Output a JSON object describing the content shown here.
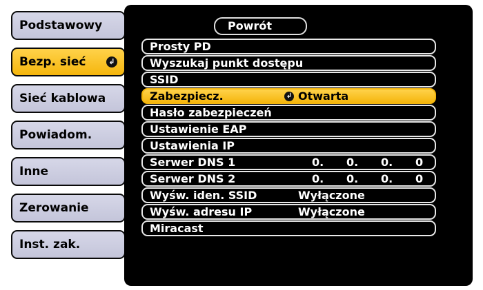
{
  "tabs": [
    {
      "label": "Podstawowy",
      "active": false
    },
    {
      "label": "Bezp. sieć",
      "active": true
    },
    {
      "label": "Sieć kablowa",
      "active": false
    },
    {
      "label": "Powiadom.",
      "active": false
    },
    {
      "label": "Inne",
      "active": false
    },
    {
      "label": "Zerowanie",
      "active": false
    },
    {
      "label": "Inst. zak.",
      "active": false
    }
  ],
  "return_label": "Powrót",
  "rows": [
    {
      "label": "Prosty PD"
    },
    {
      "label": "Wyszukaj punkt dostępu"
    },
    {
      "label": "SSID"
    },
    {
      "label": "Zabezpiecz.",
      "value": "Otwarta",
      "selected": true
    },
    {
      "label": "Hasło zabezpieczeń"
    },
    {
      "label": "Ustawienie EAP"
    },
    {
      "label": "Ustawienia IP"
    },
    {
      "label": "Serwer DNS 1",
      "ip": [
        "0.",
        "0.",
        "0.",
        "0"
      ]
    },
    {
      "label": "Serwer DNS 2",
      "ip": [
        "0.",
        "0.",
        "0.",
        "0"
      ]
    },
    {
      "label": "Wyśw. iden. SSID",
      "value": "Wyłączone"
    },
    {
      "label": "Wyśw. adresu IP",
      "value": "Wyłączone"
    },
    {
      "label": "Miracast"
    }
  ],
  "colors": {
    "accent": "#f5b60d",
    "panel": "#000000",
    "tab": "#cfd0e3"
  },
  "icons": {
    "enter": "enter-icon"
  }
}
